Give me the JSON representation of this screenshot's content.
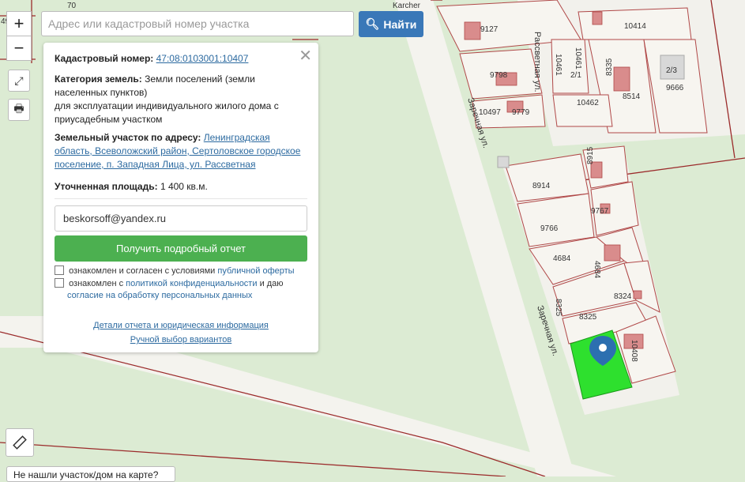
{
  "map": {
    "parcels": [
      "9127",
      "10414",
      "10461",
      "10461",
      "9798",
      "8514",
      "9666",
      "10497",
      "9779",
      "10462",
      "8335",
      "2/3",
      "2/1",
      "8915",
      "8914",
      "9767",
      "9766",
      "4684",
      "4684",
      "8324",
      "8325",
      "8325",
      "10408"
    ],
    "streets": {
      "rassvetnaya": "Рассветная ул.",
      "zarechnaya_top": "Заречная ул.",
      "zarechnaya_bottom": "Заречная ул."
    },
    "top_label": "Karcher",
    "top_left_num": "70",
    "edge_num": "49"
  },
  "search": {
    "placeholder": "Адрес или кадастровый номер участка",
    "button": "Найти"
  },
  "zoom": {
    "in": "+",
    "out": "−"
  },
  "info": {
    "cad_label": "Кадастровый номер:",
    "cad_value": "47:08:0103001:10407",
    "cat_label": "Категория земель:",
    "cat_value": "Земли поселений (земли населенных пунктов)",
    "use_value": "для эксплуатации индивидуального жилого дома с приусадебным участком",
    "addr_label": "Земельный участок по адресу:",
    "addr_value": "Ленинградская область, Всеволожский район, Сертоловское городское поселение, п. Западная Лица, ул. Рассветная",
    "area_label": "Уточненная площадь:",
    "area_value": "1 400 кв.м.",
    "email": "beskorsoff@yandex.ru",
    "report_button": "Получить подробный отчет",
    "chk1_text": "ознакомлен и согласен с условиями",
    "chk1_link": "публичной оферты",
    "chk2_text": "ознакомлен с",
    "chk2_link": "политикой конфиденциальности",
    "chk2_text2": "и даю",
    "chk2_link2": "согласие на обработку персональных данных",
    "details_link": "Детали отчета и юридическая информация",
    "manual_link": "Ручной выбор вариантов"
  },
  "footer": {
    "not_found": "Не нашли участок/дом на карте?"
  }
}
